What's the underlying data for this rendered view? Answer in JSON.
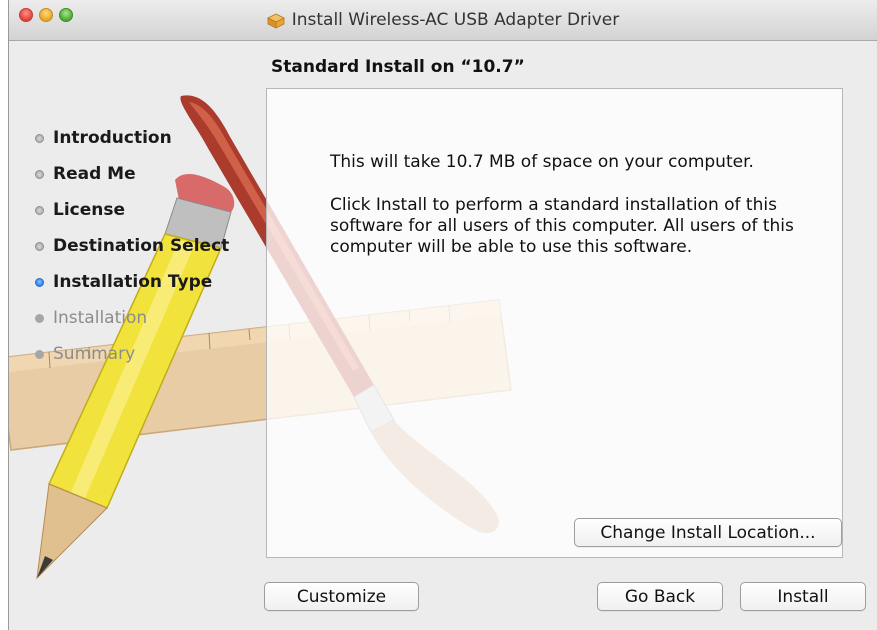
{
  "window": {
    "title": "Install Wireless-AC USB Adapter Driver",
    "icons": [
      "close-button",
      "minimize-button",
      "zoom-button",
      "package-icon"
    ]
  },
  "sidebar": {
    "steps": [
      {
        "label": "Introduction",
        "state": "done"
      },
      {
        "label": "Read Me",
        "state": "done"
      },
      {
        "label": "License",
        "state": "done"
      },
      {
        "label": "Destination Select",
        "state": "done"
      },
      {
        "label": "Installation Type",
        "state": "current"
      },
      {
        "label": "Installation",
        "state": "pending"
      },
      {
        "label": "Summary",
        "state": "pending"
      }
    ]
  },
  "main": {
    "heading": "Standard Install on “10.7”",
    "space_text": "This will take 10.7 MB of space on your computer.",
    "description": "Click Install to perform a standard installation of this software for all users of this computer. All users of this computer will be able to use this software.",
    "change_location_label": "Change Install Location..."
  },
  "footer": {
    "customize_label": "Customize",
    "go_back_label": "Go Back",
    "install_label": "Install"
  },
  "colors": {
    "current_step": "#2d7ff5",
    "close": "#e0413a",
    "minimize": "#e4a624",
    "zoom": "#4ba830"
  }
}
